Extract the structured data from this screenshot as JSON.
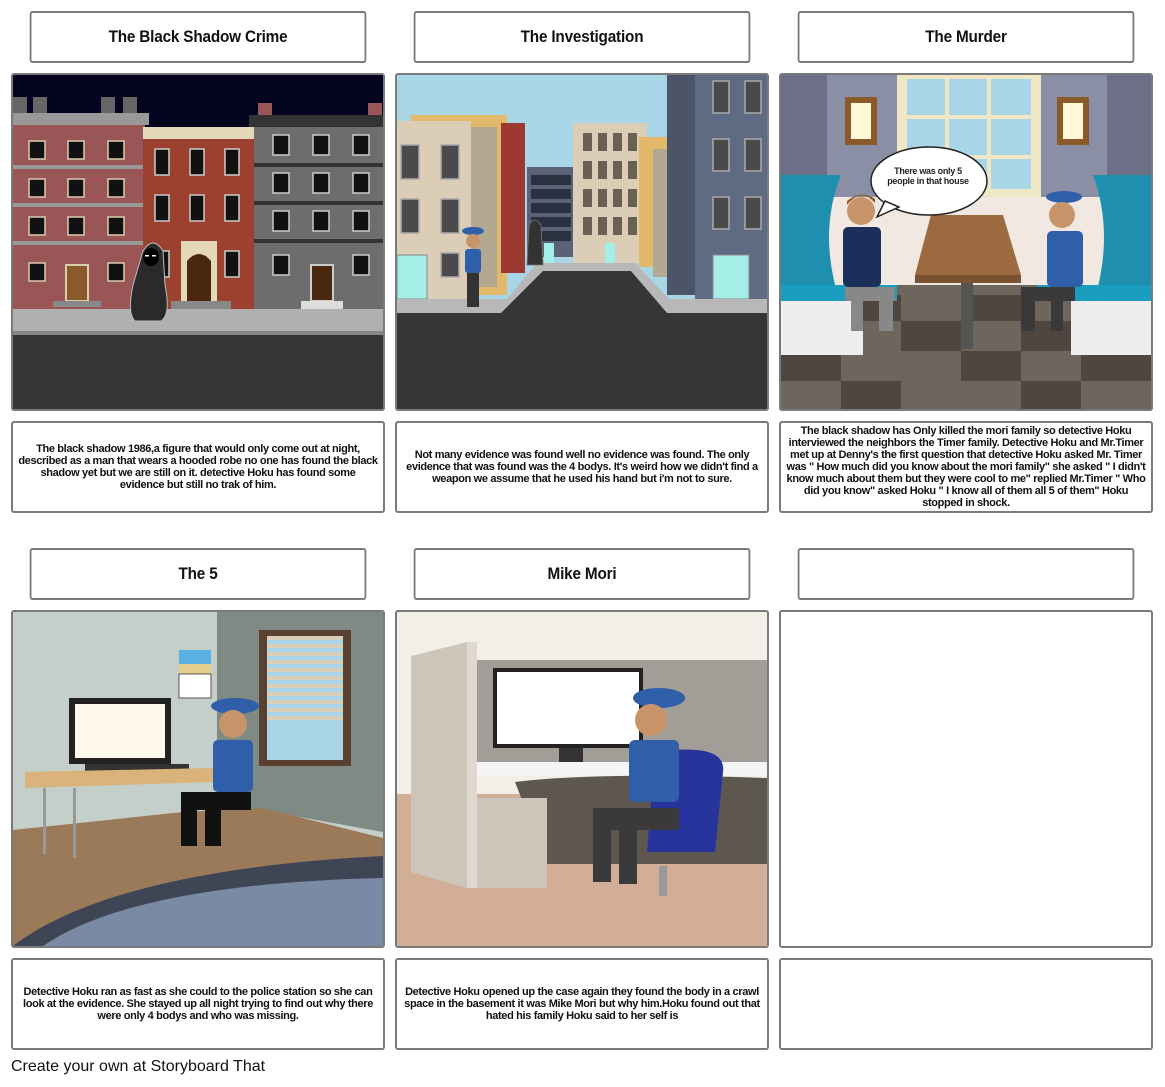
{
  "storyboard": {
    "cells": [
      {
        "title": "The Black Shadow Crime",
        "scene": "night-city-street-hooded-figure",
        "description": "The black shadow 1986,a figure that would only come out at night, described as a man that wears a hooded robe no one has found the black shadow yet but we are still on it. detective Hoku has found some evidence but still no trak of him."
      },
      {
        "title": "The Investigation",
        "scene": "daytime-city-street-officer-and-hooded-figure",
        "description": "Not many evidence was found well no evidence was found. The only evidence that was found was the 4 bodys. It's weird how we didn't find a weapon we assume that he used his hand but i'm not to sure."
      },
      {
        "title": "The Murder",
        "scene": "diner-booth-conversation",
        "speech_bubble": "There was only 5 people in that house",
        "description": "The black shadow has Only killed the mori family so detective Hoku interviewed the neighbors the Timer family. Detective Hoku and Mr.Timer met up at Denny's the first question that detective Hoku asked Mr. Timer was \" How much did you know about the mori family\" she asked \" I didn't know much about them but they were cool to me\" replied Mr.Timer \" Who did you know\" asked Hoku \" I know all of them all 5 of them\" Hoku stopped in shock."
      },
      {
        "title": "The 5",
        "scene": "office-room-officer-at-desk",
        "description": "Detective Hoku ran as fast as she could to the police station so she can look at the evidence. She stayed up all night trying to find out why there were only 4 bodys and who was missing."
      },
      {
        "title": "Mike Mori",
        "scene": "office-cubicle-officer-in-chair",
        "description": "Detective Hoku opened up the case again they found the body in a crawl space in the basement it was Mike Mori but why him.Hoku found out that hated his family Hoku said to her self is"
      },
      {
        "title": "",
        "scene": "empty",
        "description": ""
      }
    ]
  },
  "footer": {
    "text": "Create your own at Storyboard That"
  },
  "colors": {
    "border": "#7a7a7a",
    "night_sky": "#04041f",
    "day_sky": "#a8d6e6",
    "uniform_blue": "#2f5fa8",
    "booth_teal": "#1e8fae"
  }
}
